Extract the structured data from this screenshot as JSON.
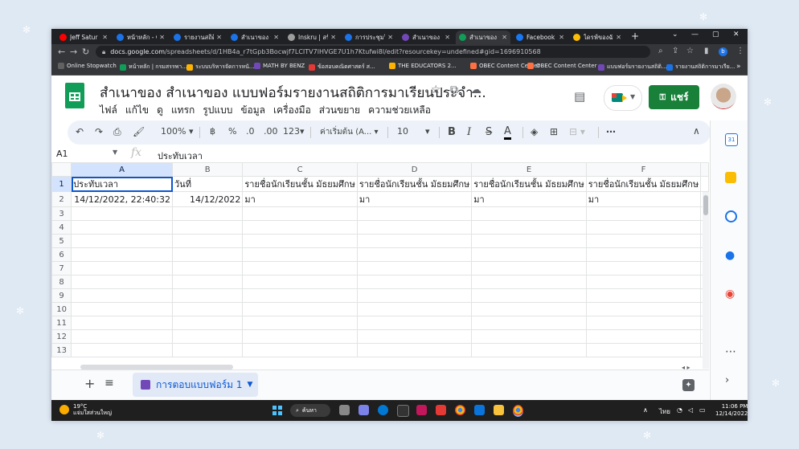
{
  "browser": {
    "tabs": [
      {
        "title": "Jeff Satur",
        "color": "#ff0000"
      },
      {
        "title": "หน้าหลัก - C",
        "color": "#1a73e8"
      },
      {
        "title": "รายงานสถิติก",
        "color": "#1a73e8"
      },
      {
        "title": "สำเนาของ รา",
        "color": "#1a73e8"
      },
      {
        "title": "Inskru | สร้า",
        "color": "#9e9e9e"
      },
      {
        "title": "การประชุมวิ",
        "color": "#1a73e8"
      },
      {
        "title": "สำเนาของ สำ",
        "color": "#7248b9"
      },
      {
        "title": "สำเนาของ สำ",
        "color": "#0f9d58"
      },
      {
        "title": "Facebook",
        "color": "#1877f2"
      },
      {
        "title": "ไดรฟ์ของฉัน",
        "color": "#fbbc04"
      }
    ],
    "url_domain": "docs.google.com",
    "url_path": "/spreadsheets/d/1HB4a_r7tGpb3Bocwjf7LCITV7lHVGE7U1h7Ktuf​wi8l/edit?resourcekey=undefined#gid=1696910568",
    "bookmarks": [
      {
        "label": "Online Stopwatch",
        "color": "#616161"
      },
      {
        "label": "หน้าหลัก | กรมสรรพา...",
        "color": "#0f9d58"
      },
      {
        "label": "ระบบบริหารจัดการหนั...",
        "color": "#ffb300"
      },
      {
        "label": "MATH BY BENZ",
        "color": "#7248b9"
      },
      {
        "label": "ข้อสอบคณิตศาสตร์ ส...",
        "color": "#e53935"
      },
      {
        "label": "THE EDUCATORS 2...",
        "color": "#ffb300"
      },
      {
        "label": "OBEC Content Center",
        "color": "#ff7043"
      },
      {
        "label": "OBEC Content Center",
        "color": "#ff7043"
      },
      {
        "label": "แบบฟอร์มรายงานสถิติ...",
        "color": "#7248b9"
      },
      {
        "label": "รายงานสถิติการมาเรีย...",
        "color": "#1a73e8"
      }
    ]
  },
  "sheets": {
    "title": "สำเนาของ สำเนาของ แบบฟอร์มรายงานสถิติการมาเรียนประจำ...",
    "menu": [
      "ไฟล์",
      "แก้ไข",
      "ดู",
      "แทรก",
      "รูปแบบ",
      "ข้อมูล",
      "เครื่องมือ",
      "ส่วนขยาย",
      "ความช่วยเหลือ"
    ],
    "share_label": "แชร์",
    "toolbar": {
      "zoom": "100%",
      "currency": "%",
      "dec_dec": ".0",
      "dec_inc": ".00",
      "format_num": "123",
      "font": "ค่าเริ่มต้น (A...",
      "font_size": "10",
      "bold": "B",
      "italic": "I",
      "strike": "S",
      "text_color": "A",
      "more": "⋯"
    },
    "name_box": "A1",
    "formula_content": "ประทับเวลา",
    "columns": [
      "A",
      "B",
      "C",
      "D",
      "E",
      "F"
    ],
    "rows": [
      [
        "ประทับเวลา",
        "วันที่",
        "รายชื่อนักเรียนชั้น มัธยมศึกษ",
        "รายชื่อนักเรียนชั้น มัธยมศึกษ",
        "รายชื่อนักเรียนชั้น มัธยมศึกษ",
        "รายชื่อนักเรียนชั้น มัธยมศึกษ"
      ],
      [
        "14/12/2022, 22:40:32",
        "14/12/2022",
        "มา",
        "มา",
        "มา",
        "มา"
      ],
      [
        "",
        "",
        "",
        "",
        "",
        ""
      ],
      [
        "",
        "",
        "",
        "",
        "",
        ""
      ],
      [
        "",
        "",
        "",
        "",
        "",
        ""
      ],
      [
        "",
        "",
        "",
        "",
        "",
        ""
      ],
      [
        "",
        "",
        "",
        "",
        "",
        ""
      ],
      [
        "",
        "",
        "",
        "",
        "",
        ""
      ],
      [
        "",
        "",
        "",
        "",
        "",
        ""
      ],
      [
        "",
        "",
        "",
        "",
        "",
        ""
      ],
      [
        "",
        "",
        "",
        "",
        "",
        ""
      ],
      [
        "",
        "",
        "",
        "",
        "",
        ""
      ],
      [
        "",
        "",
        "",
        "",
        "",
        ""
      ]
    ],
    "sheet_tab": "การตอบแบบฟอร์ม 1"
  },
  "taskbar": {
    "temp": "19°C",
    "weather": "แจ่มใสส่วนใหญ่",
    "search_label": "ค้นหา",
    "lang": "ไทย",
    "time": "11:06 PM",
    "date": "12/14/2022"
  }
}
